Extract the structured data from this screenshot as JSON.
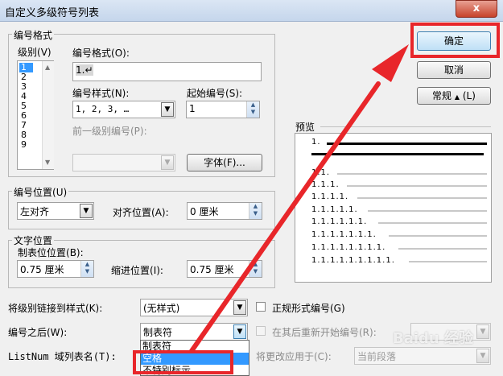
{
  "window": {
    "title": "自定义多级符号列表",
    "close_glyph": "x"
  },
  "numbering_format": {
    "group_label": "编号格式",
    "level_label": "级别",
    "level_key": "(V)",
    "levels": [
      "1",
      "2",
      "3",
      "4",
      "5",
      "6",
      "7",
      "8",
      "9"
    ],
    "selected_level": "1",
    "format_label": "编号格式",
    "format_key": "(O):",
    "format_value": "1.↵",
    "style_label": "编号样式",
    "style_key": "(N):",
    "style_value": "1, 2, 3, …",
    "start_label": "起始编号",
    "start_key": "(S):",
    "start_value": "1",
    "prev_level_label": "前一级别编号(P):",
    "font_button": "字体(F)..."
  },
  "number_position": {
    "group_label": "编号位置",
    "group_key": "(U)",
    "align_value": "左对齐",
    "align_pos_label": "对齐位置",
    "align_pos_key": "(A):",
    "align_pos_value": "0 厘米"
  },
  "text_position": {
    "group_label": "文字位置",
    "tab_label": "制表位位置",
    "tab_key": "(B):",
    "tab_value": "0.75 厘米",
    "indent_label": "缩进位置",
    "indent_key": "(I):",
    "indent_value": "0.75 厘米"
  },
  "buttons": {
    "ok": "确定",
    "cancel": "取消",
    "normal": "常规",
    "normal_arrow": "▲",
    "normal_key": "(L)"
  },
  "preview": {
    "label": "预览",
    "lines": [
      "1.",
      "1.1.",
      "1.1.1.",
      "1.1.1.1.",
      "1.1.1.1.1.",
      "1.1.1.1.1.1.",
      "1.1.1.1.1.1.1.",
      "1.1.1.1.1.1.1.1.",
      "1.1.1.1.1.1.1.1.1."
    ]
  },
  "bottom": {
    "link_style_label": "将级别链接到样式(K):",
    "link_style_value": "(无样式)",
    "legal_label": "正规形式编号(G)",
    "follow_label": "编号之后(W):",
    "follow_value": "制表符",
    "restart_label": "在其后重新开始编号(R):",
    "listnum_label": "ListNum 域列表名(T):",
    "apply_label": "将更改应用于(C):",
    "apply_value": "当前段落",
    "dropdown_options": [
      "制表符",
      "空格",
      "不特别标示"
    ],
    "selected_option": "空格"
  },
  "watermark": "Baidu 经验",
  "annotation_color": "#e8262a"
}
